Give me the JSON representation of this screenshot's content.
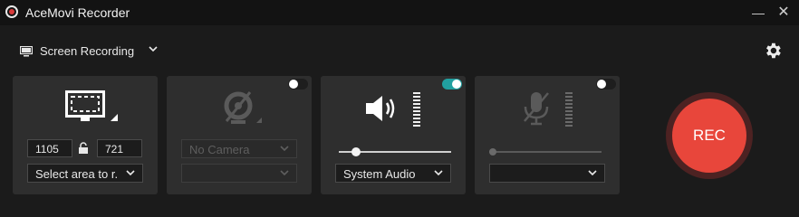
{
  "app": {
    "title": "AceMovi Recorder",
    "minimize_glyph": "—",
    "close_glyph": "✕"
  },
  "mode": {
    "label": "Screen Recording",
    "icon": "monitor-icon"
  },
  "screen_panel": {
    "width": "1105",
    "height": "721",
    "area_select": "Select area to r..."
  },
  "camera_panel": {
    "camera_select": "No Camera",
    "second_select": "",
    "enabled": false
  },
  "audio_panel": {
    "audio_select": "System Audio",
    "enabled": true,
    "volume": 0.12
  },
  "mic_panel": {
    "mic_select": "",
    "enabled": false,
    "volume": 0.0
  },
  "rec": {
    "label": "REC"
  },
  "colors": {
    "accent_toggle": "#21a0a0",
    "rec_red": "#e8463b",
    "level_green": "#34c46a"
  }
}
